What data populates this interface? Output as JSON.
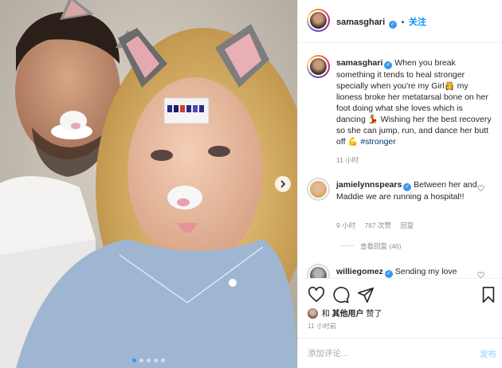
{
  "post": {
    "author": "samasghari",
    "follow_label": "关注",
    "separator": "•"
  },
  "caption": {
    "username": "samasghari",
    "text_before_tag": "When you break something it tends to heal stronger specially when you're my Girl👸 my lioness broke her metatarsal bone on her foot doing what she loves which is dancing 💃 Wishing her the best recovery so she can jump, run, and dance her butt off 💪",
    "hashtag": "#stronger",
    "time": "11 小时"
  },
  "comments": [
    {
      "username": "jamielynnspears",
      "text": "Between her and Maddie we are running a hospital!!",
      "time": "9 小时",
      "likes": "787 次赞",
      "reply_label": "回复",
      "view_replies": "查看回复 (46)"
    },
    {
      "username": "williegomez",
      "text": "Sending my love"
    }
  ],
  "likes": {
    "prefix": "和",
    "others": "其他用户",
    "suffix": "赞了"
  },
  "post_time": "11 小时前",
  "composer": {
    "placeholder": "添加评论...",
    "post_label": "发布"
  },
  "carousel": {
    "slide_count": 5,
    "active_index": 0
  },
  "icons": {
    "like": "heart-icon",
    "comment": "comment-icon",
    "share": "share-icon",
    "save": "bookmark-icon",
    "verified": "verified-badge-icon",
    "next": "chevron-right-icon"
  },
  "colors": {
    "accent": "#0095f6",
    "verified": "#3897f0",
    "muted": "#8e8e8e",
    "hashtag": "#00376b"
  }
}
